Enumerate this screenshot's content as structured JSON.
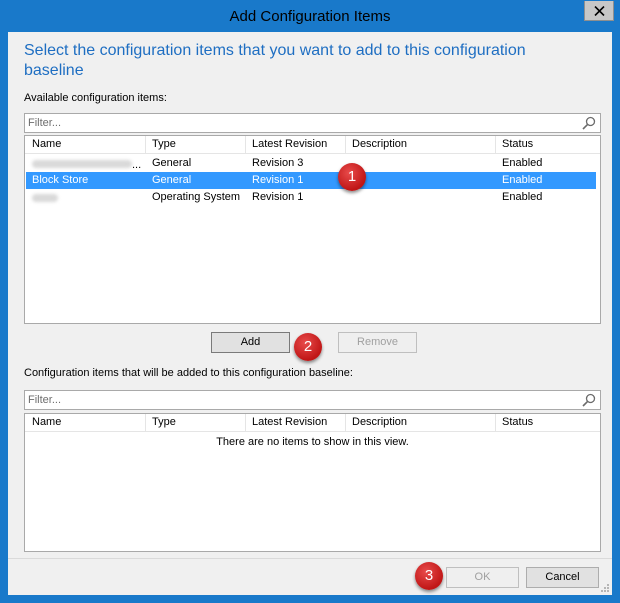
{
  "window": {
    "title": "Add Configuration Items",
    "close_icon": "close-icon"
  },
  "heading": "Select the configuration items that you want to add to this configuration baseline",
  "available": {
    "label": "Available configuration items:",
    "filter_placeholder": "Filter...",
    "columns": [
      "Name",
      "Type",
      "Latest Revision",
      "Description",
      "Status"
    ],
    "rows": [
      {
        "name": "",
        "name_suffix": "...",
        "type": "General",
        "revision": "Revision 3",
        "description": "",
        "status": "Enabled",
        "selected": false,
        "name_redacted": true
      },
      {
        "name": "Block Store",
        "name_suffix": "",
        "type": "General",
        "revision": "Revision 1",
        "description": "",
        "status": "Enabled",
        "selected": true,
        "name_redacted": false
      },
      {
        "name": "",
        "name_suffix": "",
        "type": "Operating System",
        "revision": "Revision 1",
        "description": "",
        "status": "Enabled",
        "selected": false,
        "name_redacted": true
      }
    ]
  },
  "buttons": {
    "add": "Add",
    "remove": "Remove",
    "ok": "OK",
    "cancel": "Cancel"
  },
  "to_add": {
    "label": "Configuration items that will be added to this configuration baseline:",
    "filter_placeholder": "Filter...",
    "columns": [
      "Name",
      "Type",
      "Latest Revision",
      "Description",
      "Status"
    ],
    "empty_text": "There are no items to show in this view."
  },
  "badges": [
    "1",
    "2",
    "3"
  ],
  "colors": {
    "title_bar": "#1979ca",
    "heading": "#1e6ec2",
    "selection": "#3399ff",
    "badge": "#c01616"
  }
}
